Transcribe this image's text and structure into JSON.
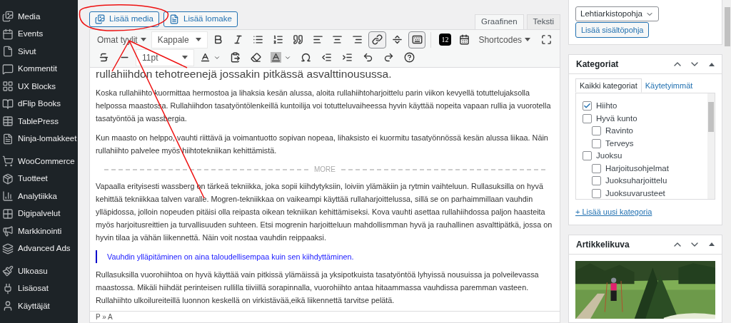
{
  "sidebar": {
    "items": [
      {
        "label": "Media",
        "kind": "media"
      },
      {
        "label": "Events",
        "kind": "events"
      },
      {
        "label": "Sivut",
        "kind": "page"
      },
      {
        "label": "Kommentit",
        "kind": "comment"
      },
      {
        "label": "UX Blocks",
        "kind": "blocks"
      },
      {
        "label": "dFlip Books",
        "kind": "book"
      },
      {
        "label": "TablePress",
        "kind": "table"
      },
      {
        "label": "Ninja-lomakkeet",
        "kind": "form"
      },
      {
        "kind": "separator"
      },
      {
        "label": "WooCommerce",
        "kind": "woo"
      },
      {
        "label": "Tuotteet",
        "kind": "product"
      },
      {
        "label": "Analytiikka",
        "kind": "chart"
      },
      {
        "label": "Digipalvelut",
        "kind": "grid"
      },
      {
        "label": "Markkinointi",
        "kind": "megaphone"
      },
      {
        "label": "Advanced Ads",
        "kind": "ads"
      },
      {
        "kind": "separator"
      },
      {
        "label": "Ulkoasu",
        "kind": "brush"
      },
      {
        "label": "Lisäosat",
        "kind": "plug"
      },
      {
        "label": "Käyttäjät",
        "kind": "user"
      }
    ]
  },
  "editor": {
    "media_buttons": [
      {
        "label": "Lisää media",
        "kind": "media"
      },
      {
        "label": "Lisää lomake",
        "kind": "form"
      }
    ],
    "tabs": [
      {
        "label": "Graafinen",
        "selected": true
      },
      {
        "label": "Teksti",
        "selected": false
      }
    ],
    "toolbar_rows": [
      [
        {
          "kind": "dropdown",
          "label": "Omat tyylit"
        },
        {
          "kind": "select",
          "label": "Kappale"
        },
        {
          "kind": "bold",
          "active": false
        },
        {
          "kind": "italic",
          "active": false
        },
        {
          "kind": "bullets",
          "active": false
        },
        {
          "kind": "numbers",
          "active": false
        },
        {
          "kind": "quote",
          "active": false
        },
        {
          "kind": "align-left",
          "active": false
        },
        {
          "kind": "align-center",
          "active": false
        },
        {
          "kind": "align-right",
          "active": false
        },
        {
          "kind": "link",
          "active": true
        },
        {
          "kind": "more",
          "active": false
        },
        {
          "kind": "keyboard",
          "active": true
        },
        {
          "kind": "sep"
        },
        {
          "kind": "badge",
          "label": "12"
        },
        {
          "kind": "calendar",
          "active": false
        },
        {
          "kind": "dropdown",
          "label": "Shortcodes"
        },
        {
          "kind": "spacer"
        },
        {
          "kind": "fullscreen",
          "active": false
        }
      ],
      [
        {
          "kind": "strike",
          "active": false
        },
        {
          "kind": "hr",
          "active": false
        },
        {
          "kind": "select",
          "label": "11pt"
        },
        {
          "kind": "color",
          "active": false
        },
        {
          "kind": "paste",
          "active": false
        },
        {
          "kind": "eraser",
          "active": false
        },
        {
          "kind": "bgcolor",
          "active": false
        },
        {
          "kind": "omega",
          "active": false
        },
        {
          "kind": "outdent",
          "active": false
        },
        {
          "kind": "indent",
          "active": false
        },
        {
          "kind": "undo",
          "active": false
        },
        {
          "kind": "redo",
          "active": false
        },
        {
          "kind": "help",
          "active": false
        }
      ]
    ],
    "content": [
      {
        "kind": "heading",
        "text": "rullahiihdon tehotreenejä jossakin pitkässä asvalttinousussa."
      },
      {
        "kind": "p",
        "text": "Koska rullahiihto kuormittaa hermostoa ja lihaksia kesän alussa, aloita rullahiihtoharjoittelu parin viikon kevyellä totuttelujaksolla helpossa maastossa. Rullahiihdon tasatyöntölenkeillä kuntoilija voi totutteluvaiheessa hyvin käyttää nopeita vapaan rullia ja vuorotella tasatyöntöä ja wassbergia."
      },
      {
        "kind": "p",
        "text": "Kun maasto on helppo, vauhti riittävä ja voimantuotto sopivan nopeaa, lihaksisto ei kuormitu tasatyönnössä kesän alussa liikaa. Näin rullahiihto palvelee myös hiihtotekniikan kehittämistä."
      },
      {
        "kind": "more",
        "text": "MORE"
      },
      {
        "kind": "p",
        "text": "Vapaalla erityisesti wassberg on tärkeä tekniikka, joka sopii kiihdytyksiin, loiviin ylämäkiin ja rytmin vaihteluun. Rullasuksilla on hyvä kehittää tekniikkaa talven varalle. Mogren-tekniikkaa on vaikeampi käyttää rullaharjoittelussa, sillä se on parhaimmillaan vauhdin ylläpidossa, jolloin nopeuden pitäisi olla reipasta oikean tekniikan kehittämiseksi. Kova vauhti asettaa rullahiihdossa paljon haasteita myös harjoitusreittien ja turvallisuuden suhteen. Etsi mogrenin harjoitteluun mahdollismman hyvä ja rauhallinen asvalttipätkä, jossa on hyvin tilaa ja vähän liikennettä. Näin voit nostaa vauhdin reippaaksi."
      },
      {
        "kind": "quote",
        "text": "Vauhdin ylläpitäminen on aina taloudellisempaa kuin sen kiihdyttäminen."
      },
      {
        "kind": "p",
        "text": "Rullasuksilla vuorohiihtoa on hyvä käyttää vain pitkissä ylämäissä ja yksipotkuista tasatyöntöä lyhyissä nousuissa ja polveilevassa maastossa. Mikäli hiihdät perinteisen rullilla tiiviillä sorapinnalla, vuorohiihto antaa hitaammassa vauhdissa paremman vasteen. Rullahiihto ulkoilureiteillä luonnon keskellä on virkistävää,eikä liikennettä tarvitse pelätä."
      }
    ],
    "path": "P » A"
  },
  "template_box": {
    "select": "Lehtiarkistopohja",
    "button": "Lisää sisältöpohja"
  },
  "categories": {
    "title": "Kategoriat",
    "tabs": [
      {
        "label": "Kaikki kategoriat",
        "selected": true
      },
      {
        "label": "Käytetyimmät",
        "selected": false
      }
    ],
    "items": [
      {
        "label": "Hiihto",
        "checked": true
      },
      {
        "label": "Hyvä kunto",
        "checked": false,
        "children": [
          {
            "label": "Ravinto",
            "checked": false
          },
          {
            "label": "Terveys",
            "checked": false
          }
        ]
      },
      {
        "label": "Juoksu",
        "checked": false,
        "children": [
          {
            "label": "Harjoitusohjelmat",
            "checked": false
          },
          {
            "label": "Juoksuharjoittelu",
            "checked": false
          },
          {
            "label": "Juoksuvarusteet",
            "checked": false
          }
        ]
      }
    ],
    "add_link": "+ Lisää uusi kategoria"
  },
  "featured_image": {
    "title": "Artikkelikuva"
  }
}
